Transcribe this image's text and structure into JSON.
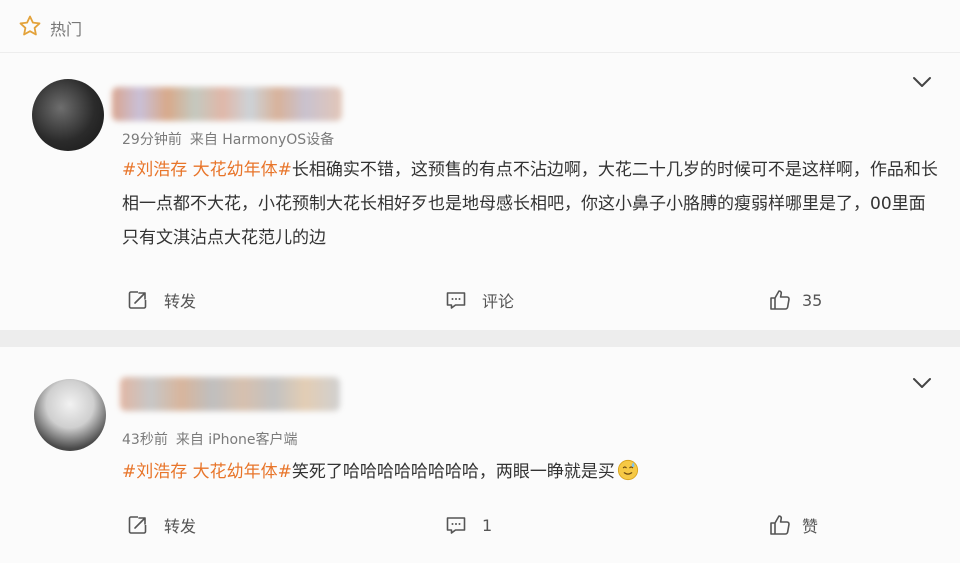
{
  "header": {
    "title": "热门",
    "icon": "star-icon"
  },
  "comments": [
    {
      "time": "29分钟前",
      "source": "来自 HarmonyOS设备",
      "topic": "#刘浩存 大花幼年体#",
      "text": "长相确实不错，这预售的有点不沾边啊，大花二十几岁的时候可不是这样啊，作品和长相一点都不大花，小花预制大花长相好歹也是地母感长相吧，你这小鼻子小胳膊的瘦弱样哪里是了，00里面只有文淇沾点大花范儿的边",
      "repost_label": "转发",
      "comment_label": "评论",
      "like_label": "35"
    },
    {
      "time": "43秒前",
      "source": "来自 iPhone客户端",
      "topic": "#刘浩存 大花幼年体#",
      "text": "笑死了哈哈哈哈哈哈哈哈，两眼一睁就是买",
      "emoji": "sweat-smile-emoji",
      "repost_label": "转发",
      "comment_label": "1",
      "like_label": "赞"
    }
  ],
  "colors": {
    "topic": "#e8752a",
    "background": "#ededed",
    "card": "#fbfbfb"
  }
}
